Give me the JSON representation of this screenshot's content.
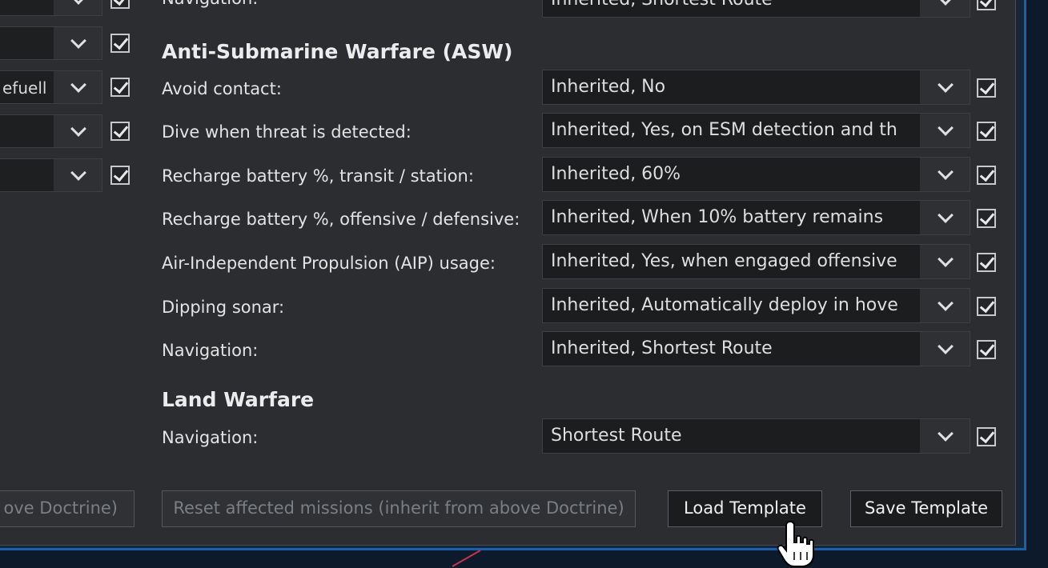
{
  "left_column": {
    "rows": [
      {
        "value": "",
        "checked": true
      },
      {
        "value": "",
        "checked": true
      },
      {
        "value": "efuell",
        "checked": true
      },
      {
        "value": "",
        "checked": true
      },
      {
        "value": "",
        "checked": true
      }
    ]
  },
  "top_partial_row": {
    "label": "Navigation:",
    "value": "Inherited, Shortest Route",
    "checked": true
  },
  "asw": {
    "title": "Anti-Submarine Warfare (ASW)",
    "rows": [
      {
        "label": "Avoid contact:",
        "value": "Inherited, No",
        "checked": true
      },
      {
        "label": "Dive when threat is detected:",
        "value": "Inherited, Yes, on ESM detection and th",
        "checked": true
      },
      {
        "label": "Recharge battery %, transit / station:",
        "value": "Inherited, 60%",
        "checked": true
      },
      {
        "label": "Recharge battery %, offensive / defensive:",
        "value": "Inherited, When 10% battery remains",
        "checked": true
      },
      {
        "label": "Air-Independent Propulsion (AIP) usage:",
        "value": "Inherited, Yes, when engaged offensive",
        "checked": true
      },
      {
        "label": "Dipping sonar:",
        "value": "Inherited, Automatically deploy in hove",
        "checked": true
      },
      {
        "label": "Navigation:",
        "value": "Inherited, Shortest Route",
        "checked": true
      }
    ]
  },
  "land": {
    "title": "Land Warfare",
    "rows": [
      {
        "label": "Navigation:",
        "value": "Shortest Route",
        "checked": true
      }
    ]
  },
  "buttons": {
    "reset_partial": "ove Doctrine)",
    "reset_missions": "Reset affected missions (inherit from above Doctrine)",
    "load_template": "Load Template",
    "save_template": "Save Template"
  },
  "colors": {
    "panel_bg": "#2b2d30",
    "frame_blue": "#1b5fa8",
    "disabled_text": "#7b7e83"
  }
}
